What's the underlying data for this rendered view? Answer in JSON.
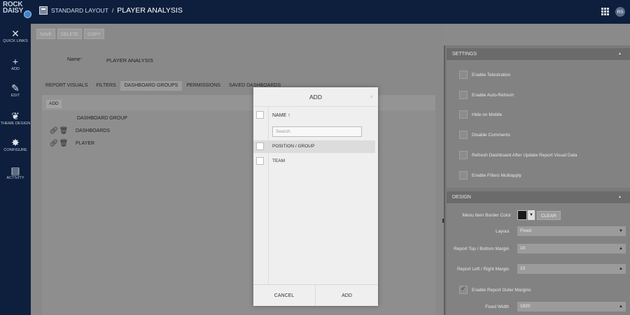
{
  "header": {
    "brand_line1": "ROCK",
    "brand_line2": "DAISY",
    "breadcrumb_layout": "STANDARD LAYOUT",
    "breadcrumb_sep": "/",
    "breadcrumb_page": "PLAYER ANALYSIS",
    "avatar_initials": "RS"
  },
  "sidebar": {
    "items": [
      {
        "icon": "tools-icon",
        "glyph": "✕",
        "label": "QUICK LINKS"
      },
      {
        "icon": "plus-icon",
        "glyph": "+",
        "label": "ADD"
      },
      {
        "icon": "edit-icon",
        "glyph": "✎",
        "label": "EDIT"
      },
      {
        "icon": "palette-icon",
        "glyph": "❦",
        "label": "THEME DESIGN"
      },
      {
        "icon": "gear-icon",
        "glyph": "✸",
        "label": "CONFIGURE"
      },
      {
        "icon": "document-icon",
        "glyph": "▤",
        "label": "ACTIVITY"
      }
    ]
  },
  "toolbar": {
    "save": "SAVE",
    "delete": "DELETE",
    "copy": "COPY"
  },
  "form": {
    "name_label": "Name",
    "name_required": "*",
    "name_value": "PLAYER ANALYSIS"
  },
  "tabs": [
    "REPORT VISUALS",
    "FILTERS",
    "DASHBOARD GROUPS",
    "PERMISSIONS",
    "SAVED DASHBOARDS"
  ],
  "groups": {
    "add_label": "ADD",
    "column_header": "DASHBOARD GROUP",
    "rows": [
      "DASHBOARDS",
      "PLAYER"
    ]
  },
  "settings": {
    "title": "SETTINGS",
    "options": [
      {
        "label": "Enable Telestration",
        "checked": false
      },
      {
        "label": "Enable Auto-Refresh",
        "checked": false
      },
      {
        "label": "Hide on Mobile",
        "checked": false
      },
      {
        "label": "Disable Comments",
        "checked": false
      },
      {
        "label": "Refresh Dashboard After Update Report Visual Data",
        "checked": false
      },
      {
        "label": "Enable Filters Multiapply",
        "checked": false
      }
    ]
  },
  "design": {
    "title": "DESIGN",
    "menu_border_label": "Menu Item Border Color",
    "menu_border_color": "#1a1a1a",
    "clear_label": "CLEAR",
    "layout_label": "Layout",
    "layout_value": "Fixed",
    "margin_tb_label": "Report Top / Bottom Margin",
    "margin_tb_value": "10",
    "margin_lr_label": "Report Left / Right Margin",
    "margin_lr_value": "10",
    "outer_margins_label": "Enable Report Outer Margins",
    "outer_margins_checked": true,
    "fixed_width_label": "Fixed Width",
    "fixed_width_value": "1920",
    "required_mark": "*"
  },
  "modal": {
    "title": "ADD",
    "close": "×",
    "column": "NAME",
    "sort_arrow": "↑",
    "search_placeholder": "Search",
    "items": [
      "POSITION / GROUP",
      "TEAM"
    ],
    "cancel": "CANCEL",
    "confirm": "ADD"
  }
}
